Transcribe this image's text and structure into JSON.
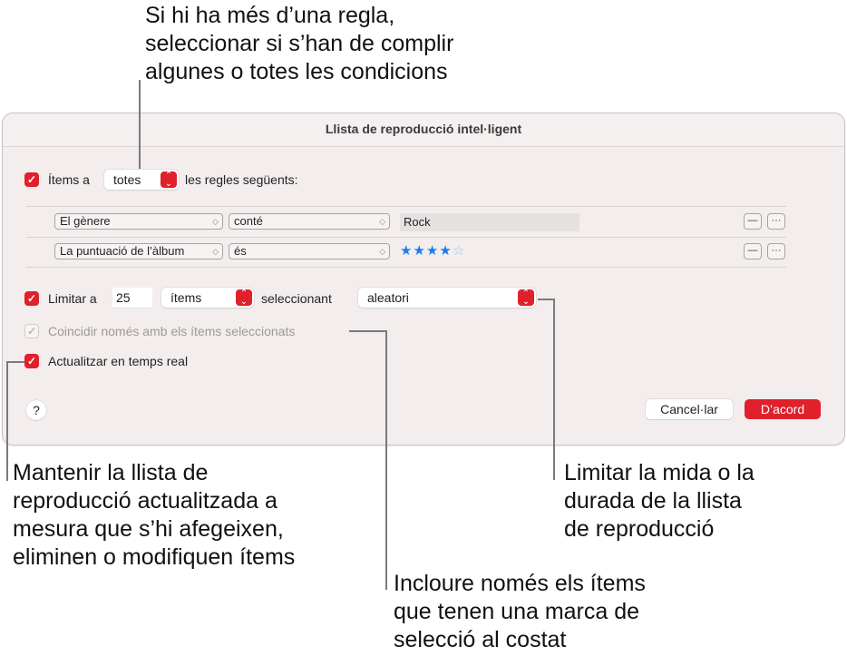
{
  "callouts": {
    "top": "Si hi ha més d’una regla,\nseleccionar si s’han de complir\nalgunes o totes les condicions",
    "live_update": "Mantenir la llista de\nreproducció actualitzada a\nmesura que s’hi afegeixen,\neliminen o modifiquen ítems",
    "checked_only": "Incloure només els ítems\nque tenen una marca de\nselecció al costat",
    "limit": "Limitar la mida o la\ndurada de la llista\nde reproducció"
  },
  "dialog": {
    "title": "Llista de reproducció intel·ligent",
    "match": {
      "checked": true,
      "prefix": "Ítems a",
      "value": "totes",
      "suffix": "les regles següents:"
    },
    "rules": [
      {
        "field": "El gènere",
        "operator": "conté",
        "value": "Rock"
      },
      {
        "field": "La puntuació de l’àlbum",
        "operator": "és",
        "rating": 4,
        "rating_max": 5
      }
    ],
    "rule_buttons": {
      "remove": "—",
      "more": "···"
    },
    "limit": {
      "checked": true,
      "label": "Limitar a",
      "amount": "25",
      "unit": "ítems",
      "selecting_label": "seleccionant",
      "selecting_value": "aleatori"
    },
    "match_checked": {
      "checked": true,
      "disabled": true,
      "label": "Coincidir només amb els ítems seleccionats"
    },
    "live_update": {
      "checked": true,
      "label": "Actualitzar en temps real"
    },
    "help_label": "?",
    "cancel_label": "Cancel·lar",
    "ok_label": "D’acord"
  },
  "colors": {
    "accent": "#e0202a",
    "star": "#1b7cf0",
    "dialog_bg": "#f3eded"
  }
}
